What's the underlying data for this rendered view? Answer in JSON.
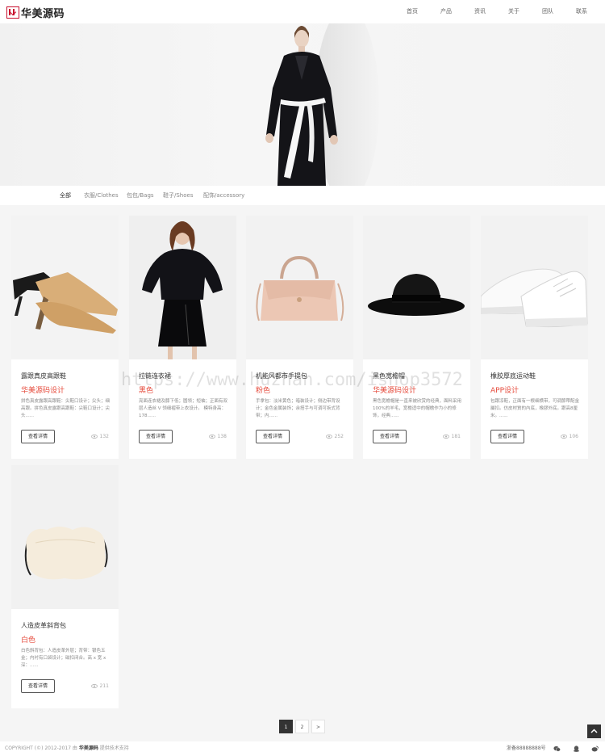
{
  "header": {
    "logo_text": "华美源码",
    "nav": [
      "首页",
      "产品",
      "资讯",
      "关于",
      "团队",
      "联系"
    ]
  },
  "filter": {
    "items": [
      "全部",
      "衣服/Clothes",
      "包包/Bags",
      "鞋子/Shoes",
      "配饰/accessory"
    ],
    "active_index": 0
  },
  "products": [
    {
      "title": "露跟真皮高跟鞋",
      "sub": "华美源码设计",
      "desc": "拼色真皮露跟高跟鞋：尖鞋口设计；尖头；细高跟。拼色真皮露跟高跟鞋：尖鞋口设计；尖头......",
      "button": "查看详情",
      "views": "132"
    },
    {
      "title": "拉链连衣裙",
      "sub": "黑色",
      "desc": "亮面连衣裙及膝下低；圆领；短袖；正面有双层人造丝 V 领细褶带上衣设计。 模特身高：178......",
      "button": "查看详情",
      "views": "138"
    },
    {
      "title": "机能风都市手提包",
      "sub": "粉色",
      "desc": "手拿包：淡米黄色；暗装设计；侧边带背设计；金色金属装饰；余搭手与可调可拆式背带；内......",
      "button": "查看详情",
      "views": "252"
    },
    {
      "title": "黑色宽檐帽",
      "sub": "华美源码设计",
      "desc": "黑色宽檐帽是一直来被欣赏的经典，面料采用100%的羊毛，宽檐适中的帽檐作为小的修饰，经典......",
      "button": "查看详情",
      "views": "181"
    },
    {
      "title": "橡胶厚底运动鞋",
      "sub": "APP设计",
      "desc": "包跟凉鞋，正面有一根细横带，可调節帶配金屬扣。仿皮材質的內底，橡膠外底。跟高8厘米。......",
      "button": "查看详情",
      "views": "106"
    },
    {
      "title": "人造皮革斜背包",
      "sub": "白色",
      "desc": "白色斜背包：人造皮革外层；背带：银色五金；内衬有口袋设计；磁扣闭合。高 x 宽 x 深：......",
      "button": "查看详情",
      "views": "211"
    }
  ],
  "pagination": {
    "pages": [
      "1",
      "2",
      ">"
    ],
    "current": "1"
  },
  "footer": {
    "copyright_prefix": "COPYRIGHT (©) 2012-2017 由",
    "brand": "华美源码",
    "copyright_suffix": "提供技术支持",
    "icp": "浙备88888888号"
  },
  "watermark": "https://www.huzhan.com/ishop3572",
  "colors": {
    "accent": "#e64b3c",
    "brand": "#c8102e",
    "dark": "#333333"
  },
  "icons": [
    "logo-mark-icon",
    "eye-icon",
    "wechat-icon",
    "qq-icon",
    "weibo-icon",
    "back-to-top-icon"
  ]
}
